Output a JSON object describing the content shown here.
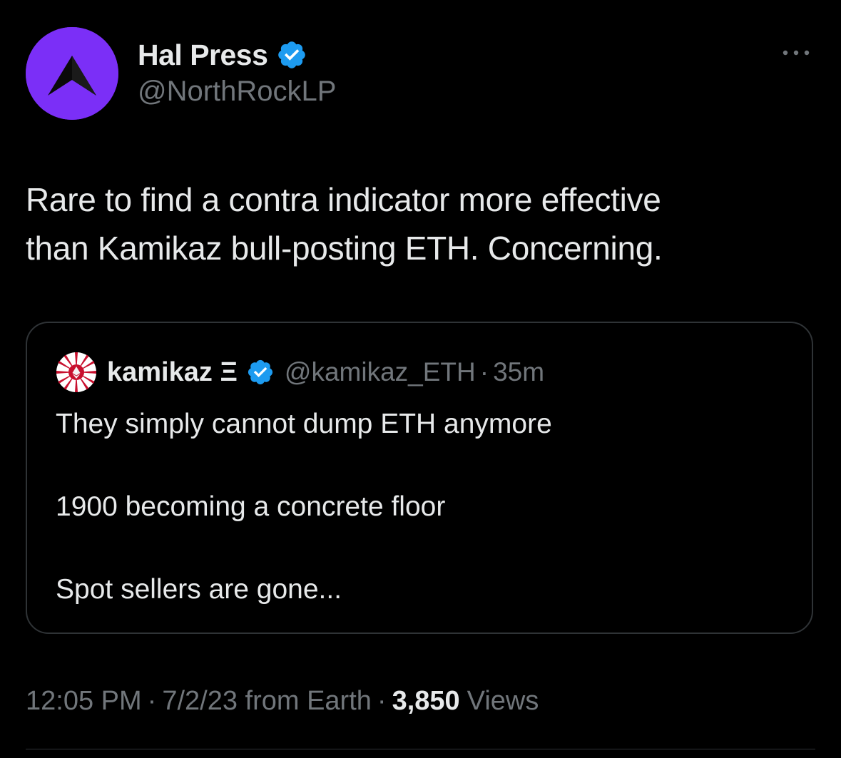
{
  "author": {
    "display_name": "Hal Press",
    "handle": "@NorthRockLP",
    "avatar_color": "#7b2ff7",
    "verified_icon": "verified-badge-icon"
  },
  "tweet": {
    "lines": [
      "Rare to find a contra indicator more effective",
      "than Kamikaz bull-posting ETH. Concerning."
    ]
  },
  "quoted": {
    "display_name": "kamikaz Ξ",
    "handle": "@kamikaz_ETH",
    "separator": "·",
    "time": "35m",
    "lines": [
      "They simply cannot dump ETH anymore",
      "1900 becoming a concrete floor",
      "Spot sellers are gone..."
    ]
  },
  "meta": {
    "time": "12:05 PM",
    "separator": "·",
    "date_source": "7/2/23 from Earth",
    "views_count": "3,850",
    "views_label": "Views"
  },
  "colors": {
    "background": "#000000",
    "text_primary": "#e7e9ea",
    "text_secondary": "#71767b",
    "verified_blue": "#1d9bf0",
    "border": "#2f3336"
  }
}
